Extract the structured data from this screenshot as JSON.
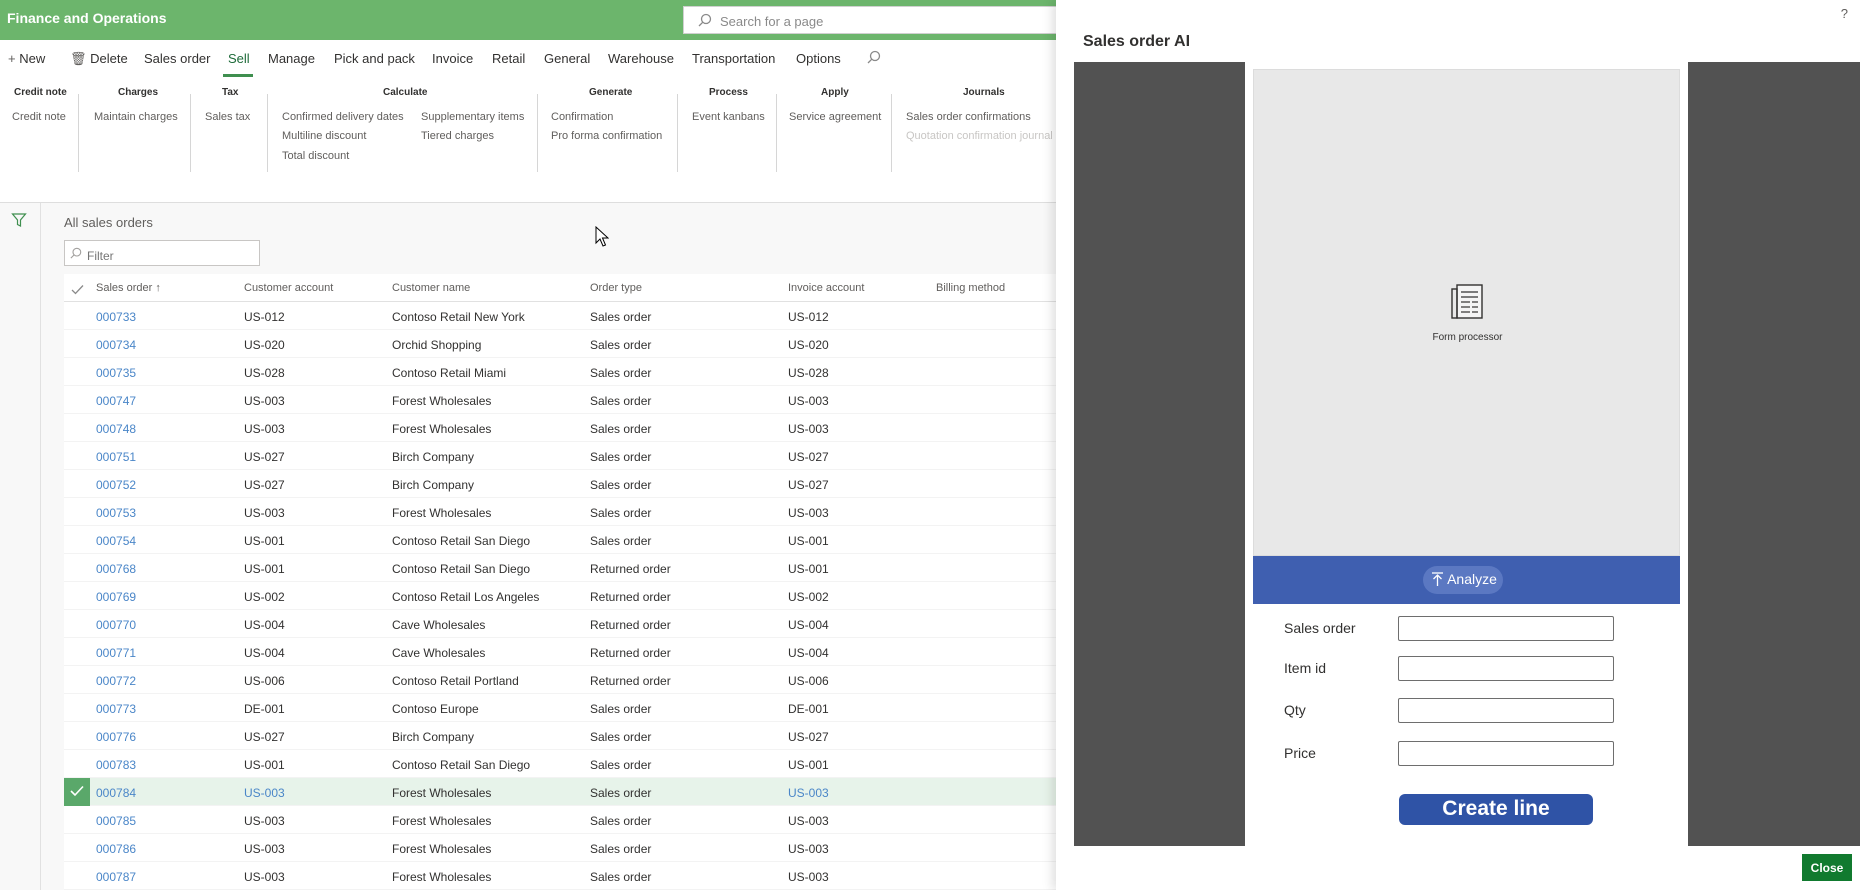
{
  "app": {
    "title": "Finance and Operations",
    "search_placeholder": "Search for a page"
  },
  "actions": {
    "new": "New",
    "delete": "Delete",
    "sales_order": "Sales order",
    "sell": "Sell",
    "manage": "Manage",
    "pick_and_pack": "Pick and pack",
    "invoice": "Invoice",
    "retail": "Retail",
    "general": "General",
    "warehouse": "Warehouse",
    "transportation": "Transportation",
    "options": "Options"
  },
  "ribbon": {
    "credit_note": {
      "title": "Credit note",
      "items": [
        "Credit note"
      ]
    },
    "charges": {
      "title": "Charges",
      "items": [
        "Maintain charges"
      ]
    },
    "tax": {
      "title": "Tax",
      "items": [
        "Sales tax"
      ]
    },
    "calculate": {
      "title": "Calculate",
      "items": [
        "Confirmed delivery dates",
        "Multiline discount",
        "Total discount",
        "Supplementary items",
        "Tiered charges"
      ]
    },
    "generate": {
      "title": "Generate",
      "items": [
        "Confirmation",
        "Pro forma confirmation"
      ]
    },
    "process": {
      "title": "Process",
      "items": [
        "Event kanbans"
      ]
    },
    "apply": {
      "title": "Apply",
      "items": [
        "Service agreement"
      ]
    },
    "journals": {
      "title": "Journals",
      "items": [
        "Sales order confirmations",
        "Quotation confirmation journal"
      ]
    }
  },
  "grid": {
    "view_title": "All sales orders",
    "filter_placeholder": "Filter",
    "columns": [
      "Sales order",
      "Customer account",
      "Customer name",
      "Order type",
      "Invoice account",
      "Billing method"
    ],
    "sort_indicator": "↑",
    "rows": [
      [
        "000733",
        "US-012",
        "Contoso Retail New York",
        "Sales order",
        "US-012"
      ],
      [
        "000734",
        "US-020",
        "Orchid Shopping",
        "Sales order",
        "US-020"
      ],
      [
        "000735",
        "US-028",
        "Contoso Retail Miami",
        "Sales order",
        "US-028"
      ],
      [
        "000747",
        "US-003",
        "Forest Wholesales",
        "Sales order",
        "US-003"
      ],
      [
        "000748",
        "US-003",
        "Forest Wholesales",
        "Sales order",
        "US-003"
      ],
      [
        "000751",
        "US-027",
        "Birch Company",
        "Sales order",
        "US-027"
      ],
      [
        "000752",
        "US-027",
        "Birch Company",
        "Sales order",
        "US-027"
      ],
      [
        "000753",
        "US-003",
        "Forest Wholesales",
        "Sales order",
        "US-003"
      ],
      [
        "000754",
        "US-001",
        "Contoso Retail San Diego",
        "Sales order",
        "US-001"
      ],
      [
        "000768",
        "US-001",
        "Contoso Retail San Diego",
        "Returned order",
        "US-001"
      ],
      [
        "000769",
        "US-002",
        "Contoso Retail Los Angeles",
        "Returned order",
        "US-002"
      ],
      [
        "000770",
        "US-004",
        "Cave Wholesales",
        "Returned order",
        "US-004"
      ],
      [
        "000771",
        "US-004",
        "Cave Wholesales",
        "Returned order",
        "US-004"
      ],
      [
        "000772",
        "US-006",
        "Contoso Retail Portland",
        "Returned order",
        "US-006"
      ],
      [
        "000773",
        "DE-001",
        "Contoso Europe",
        "Sales order",
        "DE-001"
      ],
      [
        "000776",
        "US-027",
        "Birch Company",
        "Sales order",
        "US-027"
      ],
      [
        "000783",
        "US-001",
        "Contoso Retail San Diego",
        "Sales order",
        "US-001"
      ],
      [
        "000784",
        "US-003",
        "Forest Wholesales",
        "Sales order",
        "US-003"
      ],
      [
        "000785",
        "US-003",
        "Forest Wholesales",
        "Sales order",
        "US-003"
      ],
      [
        "000786",
        "US-003",
        "Forest Wholesales",
        "Sales order",
        "US-003"
      ],
      [
        "000787",
        "US-003",
        "Forest Wholesales",
        "Sales order",
        "US-003"
      ]
    ],
    "selected_row": "000784"
  },
  "panel": {
    "title": "Sales order AI",
    "help": "?",
    "form_processor_label": "Form processor",
    "analyze_label": "Analyze",
    "fields": [
      {
        "label": "Sales order",
        "value": ""
      },
      {
        "label": "Item id",
        "value": ""
      },
      {
        "label": "Qty",
        "value": ""
      },
      {
        "label": "Price",
        "value": ""
      }
    ],
    "create_line_label": "Create line",
    "close_label": "Close"
  },
  "colors": {
    "brand_green": "#6cb56c",
    "link_blue": "#4a86c8",
    "analyze_blue": "#3f5fb0",
    "close_green": "#117a2f"
  }
}
